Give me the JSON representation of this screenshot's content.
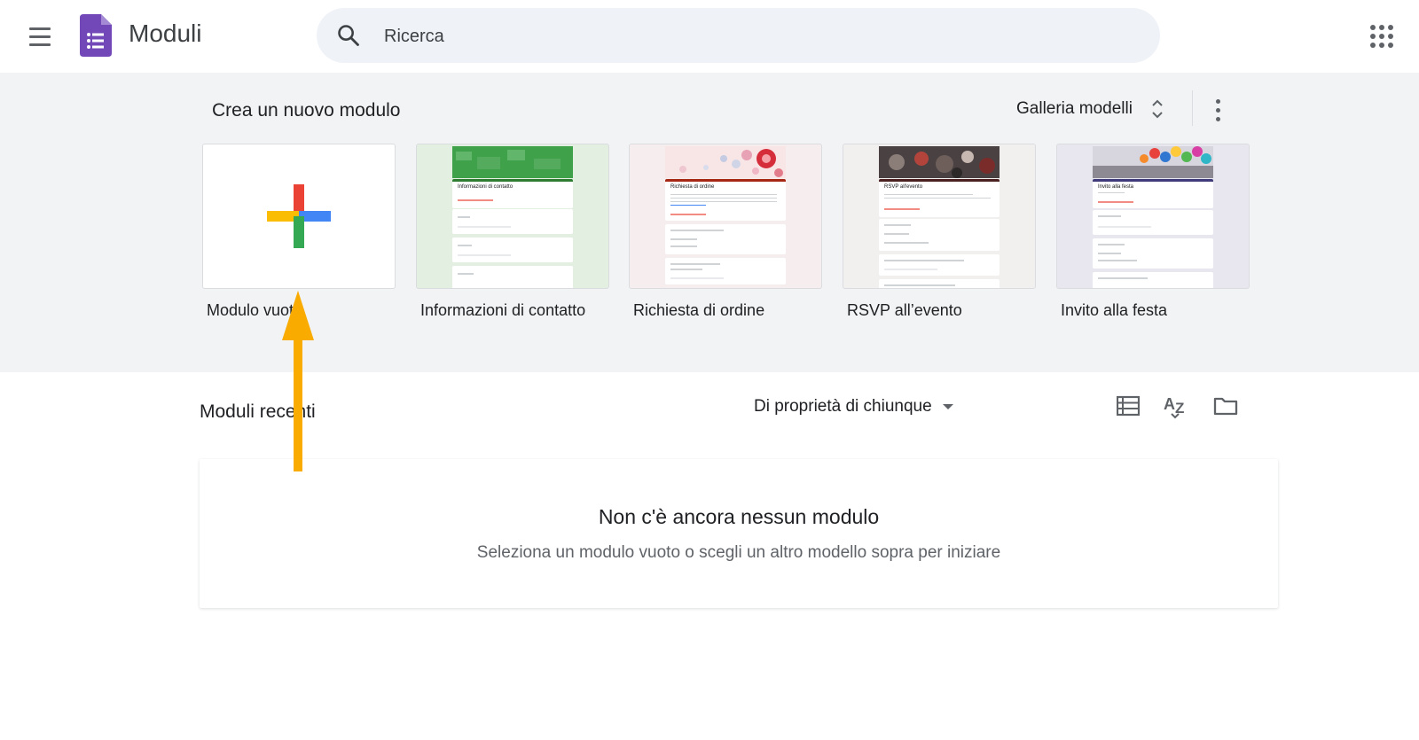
{
  "header": {
    "app_title": "Moduli",
    "search_placeholder": "Ricerca"
  },
  "new_form": {
    "title": "Crea un nuovo modulo",
    "gallery_label": "Galleria modelli",
    "templates": [
      {
        "label": "Modulo vuoto",
        "mini_title": ""
      },
      {
        "label": "Informazioni di contatto",
        "mini_title": "Informazioni di contatto"
      },
      {
        "label": "Richiesta di ordine",
        "mini_title": "Richiesta di ordine"
      },
      {
        "label": "RSVP all’evento",
        "mini_title": "RSVP all'evento"
      },
      {
        "label": "Invito alla festa",
        "mini_title": "Invito alla festa"
      }
    ]
  },
  "recent": {
    "title": "Moduli recenti",
    "owner_filter": "Di proprietà di chiunque",
    "empty_title": "Non c'è ancora nessun modulo",
    "empty_subtitle": "Seleziona un modulo vuoto o scegli un altro modello sopra per iniziare"
  },
  "colors": {
    "brand_purple": "#7248b9",
    "accent_arrow": "#f9ab00",
    "section_bg": "#f1f3f4"
  }
}
